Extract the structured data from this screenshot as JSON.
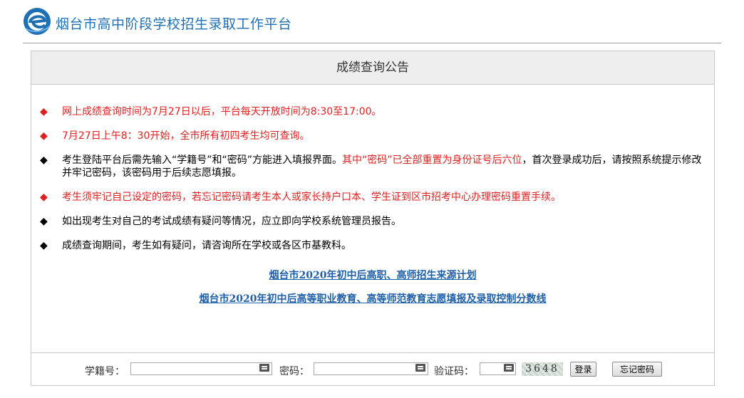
{
  "header": {
    "title": "烟台市高中阶段学校招生录取工作平台"
  },
  "panel": {
    "title": "成绩查询公告"
  },
  "notices": [
    {
      "style": "red",
      "text": "网上成绩查询时间为7月27日以后，平台每天开放时间为8:30至17:00。"
    },
    {
      "style": "red",
      "text": "7月27日上午8：30开始，全市所有初四考生均可查询。"
    },
    {
      "style": "black",
      "text_a": "考生登陆平台后需先输入“学籍号”和“密码”方能进入填报界面。",
      "text_highlight": "其中“密码”已全部重置为身份证号后六位",
      "text_b": "，首次登录成功后，请按照系统提示修改并牢记密码，该密码用于后续志愿填报。"
    },
    {
      "style": "red",
      "text": "考生须牢记自己设定的密码，若忘记密码请考生本人或家长持户口本、学生证到区市招考中心办理密码重置手续。"
    },
    {
      "style": "black",
      "text": "如出现考生对自己的考试成绩有疑问等情况，应立即向学校系统管理员报告。"
    },
    {
      "style": "black",
      "text": "成绩查询期间，考生如有疑问，请咨询所在学校或各区市基教科。"
    }
  ],
  "bullet": "◆",
  "links": [
    "烟台市2020年初中后高职、高师招生来源计划",
    "烟台市2020年初中后高等职业教育、高等师范教育志愿填报及录取控制分数线"
  ],
  "login": {
    "student_id_label": "学籍号：",
    "student_id_value": "",
    "password_label": "密码：",
    "password_value": "",
    "captcha_label": "验证码：",
    "captcha_value": "",
    "captcha_text": "3648",
    "login_button": "登录",
    "forgot_button": "忘记密码"
  },
  "colors": {
    "accent_blue": "#1f6fb5",
    "notice_red": "#e02020"
  },
  "icons": {
    "logo": "e-globe-logo",
    "keyboard": "soft-keyboard-icon"
  }
}
